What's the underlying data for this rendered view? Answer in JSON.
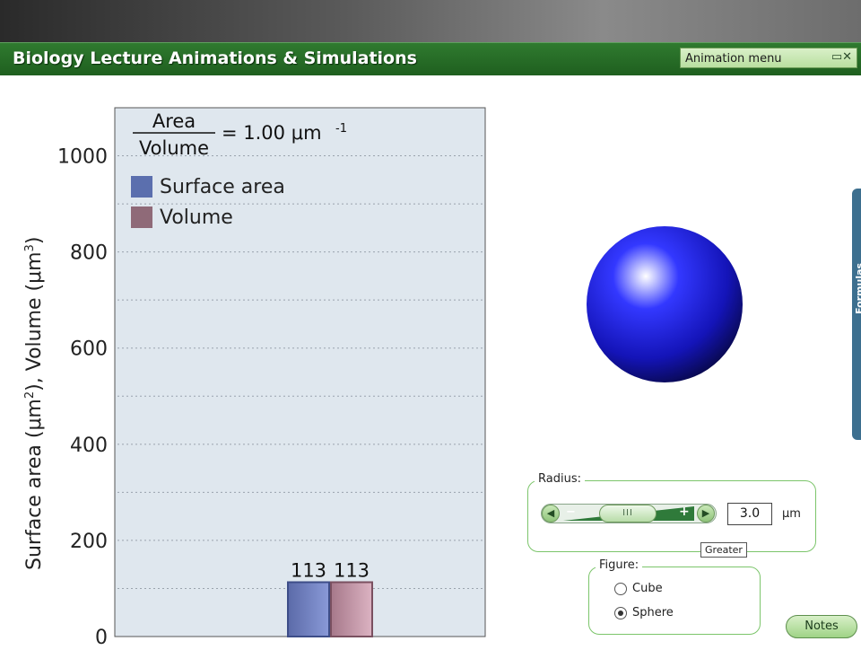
{
  "app": {
    "title": "Biology Lecture Animations & Simulations",
    "menu_label": "Animation menu",
    "menu_icons": "▭✕"
  },
  "ratio": {
    "numerator": "Area",
    "denominator": "Volume",
    "value_text": "= 1.00 μm",
    "exponent": "-1"
  },
  "chart_data": {
    "type": "bar",
    "categories": [
      "Surface area",
      "Volume"
    ],
    "values": [
      113,
      113
    ],
    "value_labels": [
      "113",
      "113"
    ],
    "ylabel_prefix": "Surface area (μm",
    "ylabel_mid": "), Volume (μm",
    "ylabel_suffix": ")",
    "ylabel_sup1": "2",
    "ylabel_sup2": "3",
    "ylim": [
      0,
      1100
    ],
    "ticks": [
      0,
      200,
      400,
      600,
      800,
      1000
    ],
    "tick_labels": [
      "0",
      "200",
      "400",
      "600",
      "800",
      "1000"
    ],
    "grid": true,
    "legend": [
      {
        "name": "Surface area",
        "color": "#5b6fae"
      },
      {
        "name": "Volume",
        "color": "#8f6a78"
      }
    ],
    "colors": {
      "surface": "#6f80c4",
      "volume": "#c896a6",
      "background": "#dfe7ee"
    }
  },
  "side_tab": {
    "label": "Formulas"
  },
  "controls": {
    "radius_legend": "Radius:",
    "slider_minus": "−",
    "slider_plus": "+",
    "slider_grip": "III",
    "slider_left_arrow": "◀",
    "slider_right_arrow": "▶",
    "radius_value": "3.0",
    "radius_unit": "μm",
    "tooltip": "Greater",
    "figure_legend": "Figure:",
    "figure_options": [
      "Cube",
      "Sphere"
    ],
    "figure_selected": "Sphere",
    "notes_label": "Notes"
  },
  "shape": {
    "name": "sphere",
    "color": "#1a1fd0"
  }
}
